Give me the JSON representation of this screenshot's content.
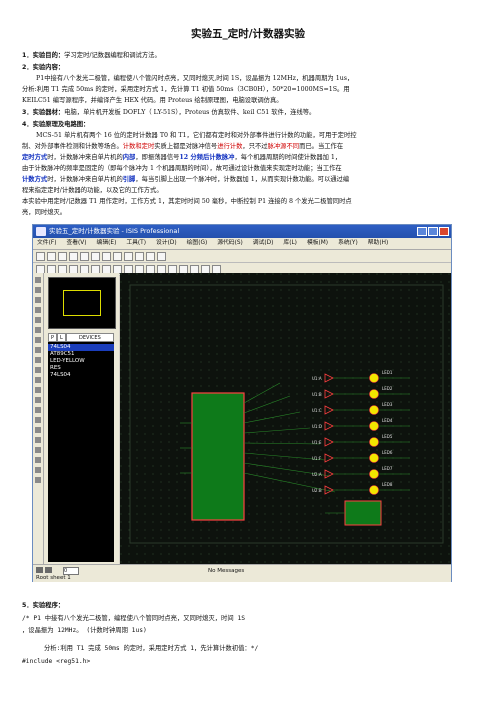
{
  "title": "实验五_定时/计数器实验",
  "s1": {
    "head": "1．实验目的：",
    "body": "学习定时/记数器编程和调试方法。"
  },
  "s2": {
    "head": "2．实验内容：",
    "line1": "P1中接有八个发光二极管，编程使八个管闪时点亮，又同时熄灭,时间 1S，设晶振为 12MHz，机器周期为 1us，",
    "line2": "分析:利用 T1 完成 50ms 的定时，采用定时方式 1，先计算 T1 初值 50ms（3CB0H），50*20=1000MS=1S。用",
    "line3": "KEILC51 编写源程序，并编译产生 HEX 代码。用 Proteus 绘制原理图，电脑设联调仿真。"
  },
  "s3": {
    "head": "3．实验器材：",
    "body": "电脑，单片机开发板 DOFLY（ LY-51S），Proteus 仿真软件、keil C51 软件，连线等。"
  },
  "s4": {
    "head": "4．实验原理及电路图：",
    "l1": "MCS-51 单片机有两个 16 位的定时计数器 T0 和 T1，它们都有定时和对外部事件进行计数的功能，可用于定时控",
    "l2a": "制、对外部事件检测和计数等场合。",
    "l2red": "计数和定时",
    "l2b": "实质上都是对脉冲信号",
    "l2red2": "进行计数",
    "l2c": "，只不过",
    "l2red3": "脉冲源不同",
    "l2d": "而已。当工作在",
    "l3blue": "定时方式",
    "l3a": "时，计数脉冲来自单片机的",
    "l3blue2": "内部",
    "l3b": "，即振荡器信号",
    "l3blue3": "12 分频后计数脉冲",
    "l3c": "，每个机器周期的时间使计数器加 1，",
    "l4": "由于计数脉冲的频率是固定的（即每个脉冲为 1 个机器周期的时间），故可通过设计数值来实现定时功能；当工作在",
    "l5blue": "计数方式",
    "l5a": "时，计数脉冲来自单片机的",
    "l5blue2": "引脚",
    "l5b": "，每当引脚上出现一个脉冲时，计数器加 1，从而实现计数功能。可以通过编",
    "l6": "程来指定定时/计数器的功能，以及它的工作方式。",
    "l7": "本实验中用定时/记数器 T1 用作定时，工作方式 1，其定时时间 50 毫秒，中断控制 P1 连接的 8 个发光二极管同时点",
    "l8": "亮，同时熄灭。"
  },
  "screenshot": {
    "window_title": "实验五_定时/计数器实验 - ISIS Professional",
    "menu": [
      "文件(F)",
      "查看(V)",
      "编辑(E)",
      "工具(T)",
      "设计(D)",
      "绘图(G)",
      "源代码(S)",
      "调试(D)",
      "库(L)",
      "模板(M)",
      "系统(Y)",
      "帮助(H)"
    ],
    "devices_tab_p": "P",
    "devices_tab_l": "L",
    "devices_label": "DEVICES",
    "devices": [
      "74LS04",
      "AT89C51",
      "LED-YELLOW",
      "RES",
      "74LS04"
    ],
    "status_message": "No Messages",
    "sheet": "Root sheet 1",
    "step_count": "0",
    "led_labels": [
      "U1:A",
      "U1:B",
      "U1:C",
      "U1:D",
      "U1:E",
      "U1:F",
      "U2:A",
      "U2:B"
    ],
    "led_names": [
      "LED1",
      "LED2",
      "LED3",
      "LED4",
      "LED5",
      "LED6",
      "LED7",
      "LED8"
    ]
  },
  "s5": {
    "head": "5．实验程序：",
    "l1": "/*   P1 中接有八个发光二极管，编程使八个管同时点亮，又同时熄灭，时间 1S",
    "l2": "，设晶振为 12MHz。  (计数时钟周期 1us)",
    "l3": "分析:利用 T1 完成 50ms 的定时，采用定时方式 1，先计算计数初值：*/",
    "l4": "#include <reg51.h>"
  }
}
